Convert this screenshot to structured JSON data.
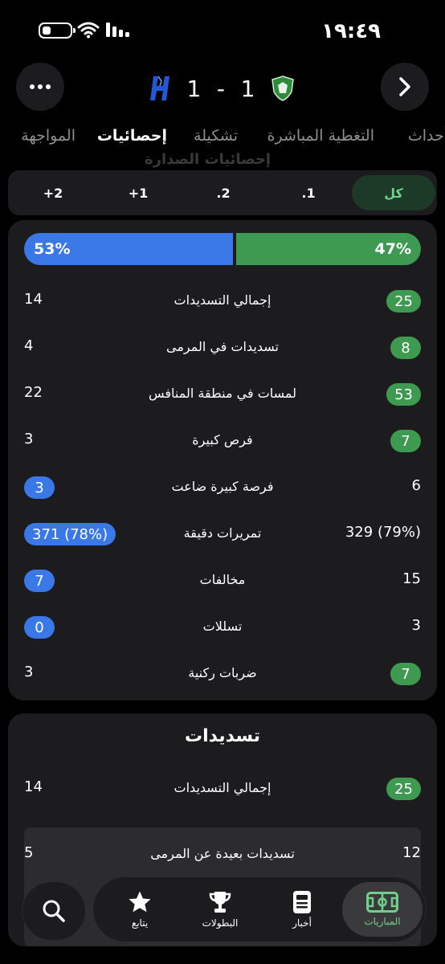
{
  "status_bar": {
    "time": "١٩:٤٩"
  },
  "header": {
    "home_score": "1",
    "separator": "-",
    "away_score": "1"
  },
  "tabs": [
    {
      "label": "أحداث"
    },
    {
      "label": "التغطية المباشرة"
    },
    {
      "label": "تشكيلة"
    },
    {
      "label": "إحصائيات"
    },
    {
      "label": "المواجهة"
    }
  ],
  "ghost_section_title": "إحصائيات الصدارة",
  "periods": [
    {
      "label": "كل"
    },
    {
      "label": ".1"
    },
    {
      "label": ".2"
    },
    {
      "label": "+1"
    },
    {
      "label": "+2"
    }
  ],
  "possession": {
    "left": "53%",
    "right": "47%",
    "left_fraction": 0.53,
    "right_fraction": 0.47
  },
  "stats": [
    {
      "label": "إجمالي التسديدات",
      "left": "14",
      "right": "25",
      "highlight": "right"
    },
    {
      "label": "تسديدات في المرمى",
      "left": "4",
      "right": "8",
      "highlight": "right"
    },
    {
      "label": "لمسات في منطقة المنافس",
      "left": "22",
      "right": "53",
      "highlight": "right"
    },
    {
      "label": "فرص كبيرة",
      "left": "3",
      "right": "7",
      "highlight": "right"
    },
    {
      "label": "فرصة كبيرة ضاعت",
      "left": "3",
      "right": "6",
      "highlight": "left"
    },
    {
      "label": "تمريرات دقيقة",
      "left": "371 (78%)",
      "right": "329 (79%)",
      "highlight": "left"
    },
    {
      "label": "مخالفات",
      "left": "7",
      "right": "15",
      "highlight": "left"
    },
    {
      "label": "تسللات",
      "left": "0",
      "right": "3",
      "highlight": "left"
    },
    {
      "label": "ضربات ركنية",
      "left": "3",
      "right": "7",
      "highlight": "right"
    }
  ],
  "shots_section": {
    "title": "تسديدات",
    "rows": [
      {
        "label": "إجمالي التسديدات",
        "left": "14",
        "right": "25",
        "highlight": "right"
      },
      {
        "label": "تسديدات بعيدة عن المرمى",
        "left": "5",
        "right": "12",
        "highlight": "none"
      }
    ]
  },
  "bottom_nav": [
    {
      "label": "المباريات"
    },
    {
      "label": "أخبار"
    },
    {
      "label": "البطولات"
    },
    {
      "label": "يتابع"
    }
  ],
  "colors": {
    "green": "#3e9a51",
    "blue": "#3b78e7",
    "accent": "#6fd08c"
  }
}
